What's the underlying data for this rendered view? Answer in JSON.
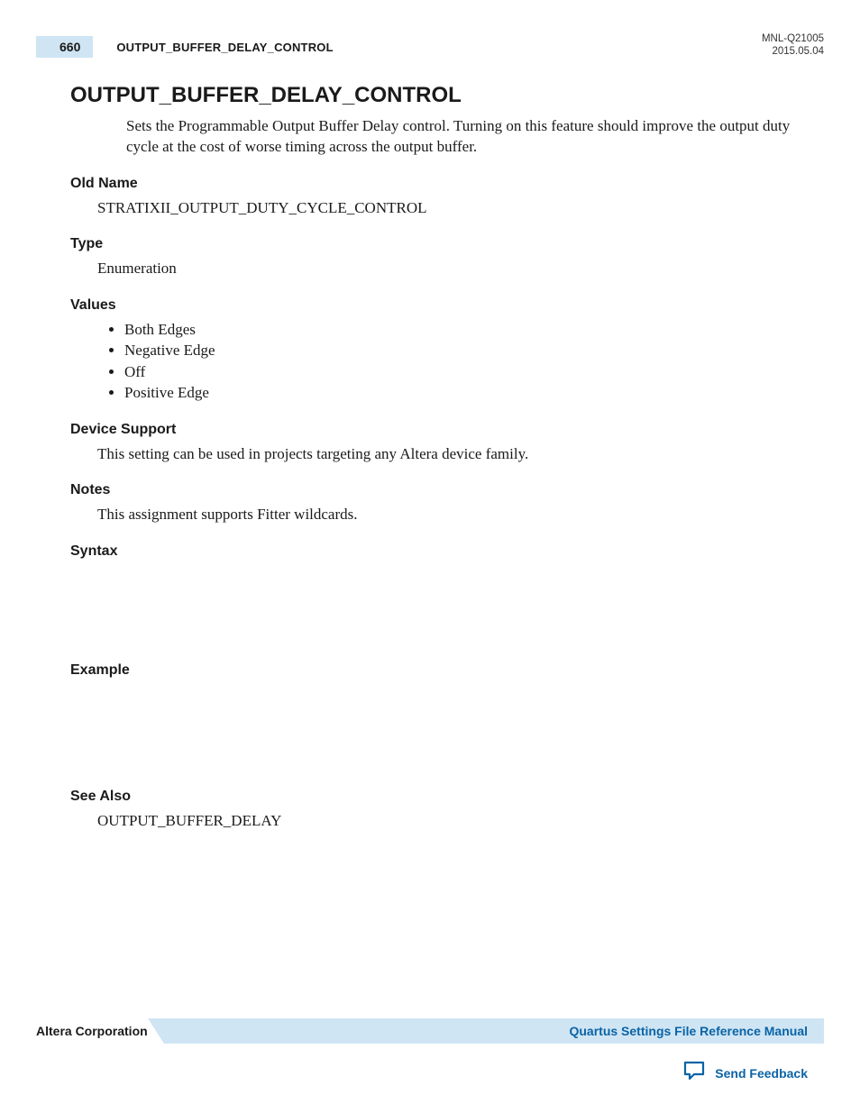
{
  "header": {
    "page_number": "660",
    "running_title": "OUTPUT_BUFFER_DELAY_CONTROL",
    "doc_id": "MNL-Q21005",
    "doc_date": "2015.05.04"
  },
  "title": "OUTPUT_BUFFER_DELAY_CONTROL",
  "intro": "Sets the Programmable Output Buffer Delay control. Turning on this feature should improve the output duty cycle at the cost of worse timing across the output buffer.",
  "sections": {
    "old_name": {
      "heading": "Old Name",
      "text": "STRATIXII_OUTPUT_DUTY_CYCLE_CONTROL"
    },
    "type": {
      "heading": "Type",
      "text": "Enumeration"
    },
    "values": {
      "heading": "Values",
      "items": [
        "Both Edges",
        "Negative Edge",
        "Off",
        "Positive Edge"
      ]
    },
    "device_support": {
      "heading": "Device Support",
      "text": "This setting can be used in projects targeting any Altera device family."
    },
    "notes": {
      "heading": "Notes",
      "text": "This assignment supports Fitter wildcards."
    },
    "syntax": {
      "heading": "Syntax"
    },
    "example": {
      "heading": "Example"
    },
    "see_also": {
      "heading": "See Also",
      "text": "OUTPUT_BUFFER_DELAY"
    }
  },
  "footer": {
    "company": "Altera Corporation",
    "manual_link": "Quartus Settings File Reference Manual",
    "feedback": "Send Feedback"
  }
}
